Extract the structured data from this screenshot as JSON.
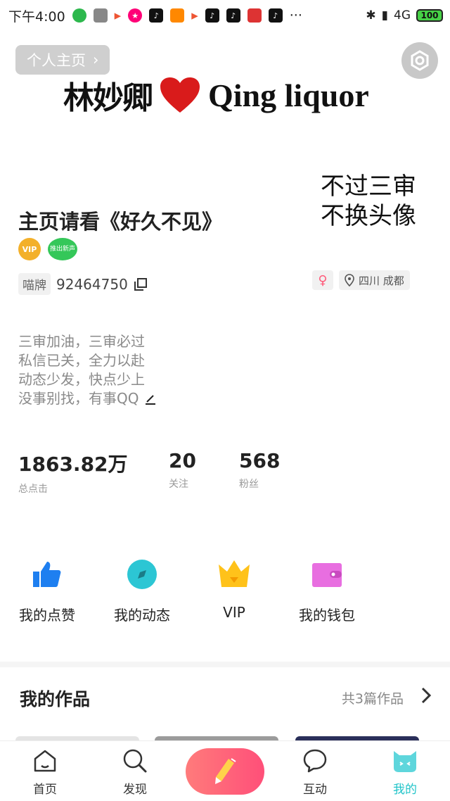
{
  "status_bar": {
    "time": "下午4:00",
    "network": "4G",
    "battery": "100"
  },
  "header": {
    "profile_link_label": "个人主页",
    "banner_cn": "林妙卿",
    "banner_en": "Qing liquor"
  },
  "avatar_text": [
    "不过三审",
    "不换头像"
  ],
  "profile": {
    "title": "主页请看《好久不见》",
    "vip_badge": "VIP",
    "medal_badge": "推出新声",
    "id_tag": "喵牌",
    "id_number": "92464750",
    "location": "四川 成都",
    "gender_symbol": "♀"
  },
  "bio": [
    "三审加油，三审必过",
    "私信已关，全力以赴",
    "动态少发，快点少上",
    "没事别找，有事QQ"
  ],
  "stats": [
    {
      "value": "1863.82万",
      "label": "总点击"
    },
    {
      "value": "20",
      "label": "关注"
    },
    {
      "value": "568",
      "label": "粉丝"
    }
  ],
  "quick_actions": [
    {
      "label": "我的点赞",
      "icon": "thumbs-up-icon",
      "color": "#1e7ff0"
    },
    {
      "label": "我的动态",
      "icon": "compass-icon",
      "color": "#2cc6d4"
    },
    {
      "label": "VIP",
      "icon": "crown-icon",
      "color": "#ffc21a"
    },
    {
      "label": "我的钱包",
      "icon": "wallet-icon",
      "color": "#e86ee0"
    }
  ],
  "works": {
    "title": "我的作品",
    "count_text": "共3篇作品"
  },
  "tabbar": [
    {
      "label": "首页",
      "icon": "home-icon"
    },
    {
      "label": "发现",
      "icon": "search-icon"
    },
    {
      "label": "",
      "icon": "pencil-icon"
    },
    {
      "label": "互动",
      "icon": "chat-icon"
    },
    {
      "label": "我的",
      "icon": "cat-icon"
    }
  ],
  "colors": {
    "accent": "#21c4c9",
    "create_button": "#ff4f79"
  }
}
